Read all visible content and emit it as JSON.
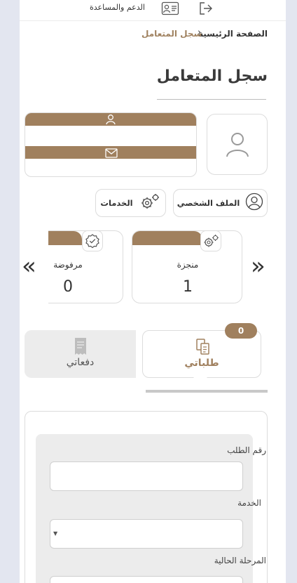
{
  "topbar": {
    "help_label": "الدعم والمساعدة",
    "icons": [
      "id-card-icon",
      "sign-out-icon"
    ]
  },
  "breadcrumb": {
    "home": "الصفحة الرئيسية",
    "separator": "›",
    "current": "سجل المتعامل"
  },
  "page_title": "سجل المتعامل",
  "profile": {
    "name": "",
    "email": "",
    "icons": [
      "user-icon",
      "envelope-icon",
      "avatar-icon"
    ]
  },
  "actions": {
    "profile_label": "الملف الشخصي",
    "services_label": "الخدمات"
  },
  "stats": [
    {
      "label": "منجزة",
      "value": "1",
      "icon": "gears-icon"
    },
    {
      "label": "مرفوضة",
      "value": "0",
      "icon": "check-badge-icon"
    }
  ],
  "nav": {
    "next": "»",
    "prev": "«"
  },
  "tabs": [
    {
      "label": "طلباتي",
      "badge": "0",
      "active": true,
      "icon": "documents-icon"
    },
    {
      "label": "دفعاتي",
      "active": false,
      "icon": "receipt-icon"
    }
  ],
  "form": {
    "request_number_label": "رقم الطلب",
    "request_number_value": "",
    "service_label": "الخدمة",
    "service_value": "",
    "stage_label": "المرحلة الحالية",
    "stage_value": ""
  },
  "colors": {
    "accent": "#a0805e",
    "page_bg": "#e3e6f0",
    "panel_gray": "#ececec"
  }
}
